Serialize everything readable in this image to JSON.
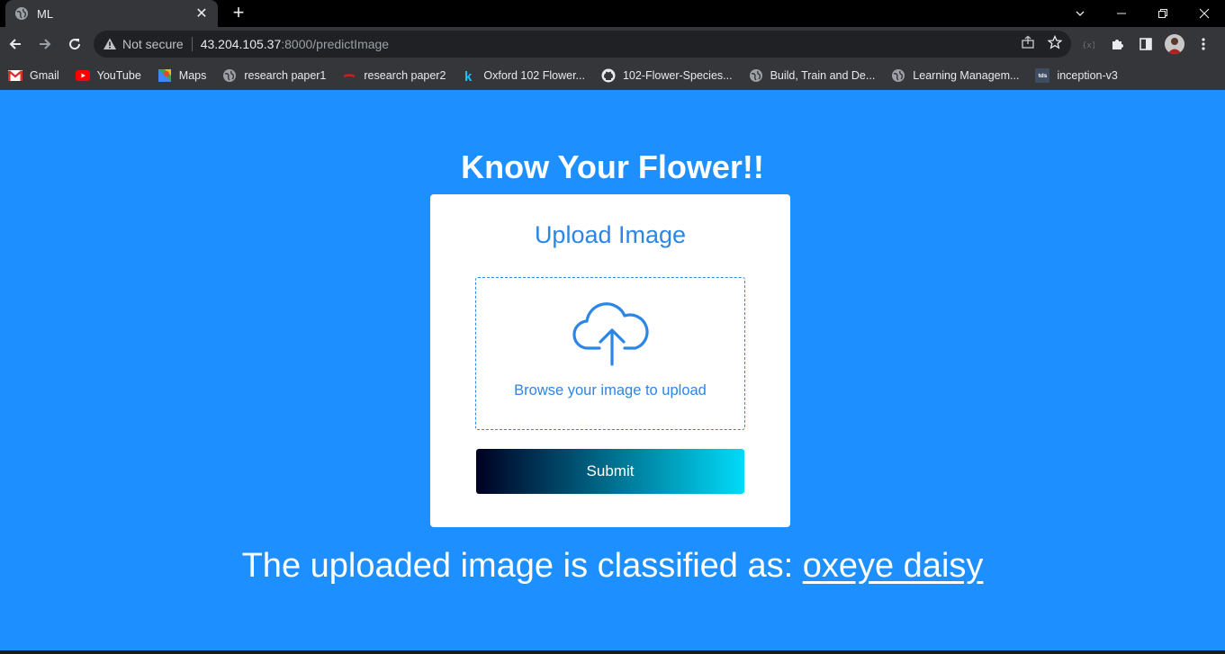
{
  "browser": {
    "tab_title": "ML",
    "tab_close": "✕",
    "new_tab": "+",
    "not_secure": "Not secure",
    "url_host": "43.204.105.37",
    "url_path": ":8000/predictImage",
    "bookmarks": [
      {
        "label": "Gmail",
        "icon": "gmail-icon"
      },
      {
        "label": "YouTube",
        "icon": "youtube-icon"
      },
      {
        "label": "Maps",
        "icon": "maps-icon"
      },
      {
        "label": "research paper1",
        "icon": "globe-icon"
      },
      {
        "label": "research paper2",
        "icon": "research-icon"
      },
      {
        "label": "Oxford 102 Flower...",
        "icon": "kaggle-icon"
      },
      {
        "label": "102-Flower-Species...",
        "icon": "github-icon"
      },
      {
        "label": "Build, Train and De...",
        "icon": "globe-icon"
      },
      {
        "label": "Learning Managem...",
        "icon": "globe-icon"
      },
      {
        "label": "inception-v3",
        "icon": "tds-icon"
      }
    ],
    "tds_text": "tds"
  },
  "page": {
    "heading": "Know Your Flower!!",
    "upload_title": "Upload Image",
    "dropzone_text": "Browse your image to upload",
    "submit_label": "Submit",
    "result_prefix": "The uploaded image is classified as: ",
    "result_value": "oxeye daisy"
  },
  "colors": {
    "page_bg": "#1e8fff",
    "accent": "#2b86e6",
    "button_gradient_start": "#000022",
    "button_gradient_end": "#00dbf8"
  }
}
